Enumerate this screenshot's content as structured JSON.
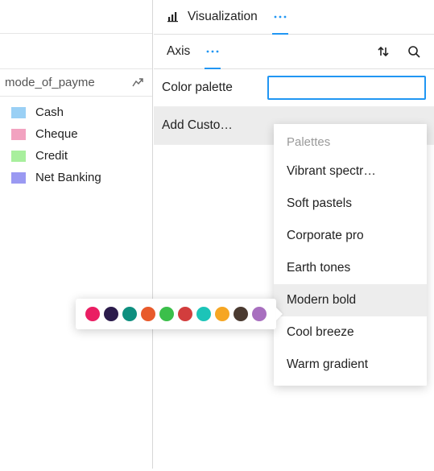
{
  "legend": {
    "title": "mode_of_payme",
    "items": [
      {
        "label": "Cash",
        "color": "#9ad0f5"
      },
      {
        "label": "Cheque",
        "color": "#f2a2c0"
      },
      {
        "label": "Credit",
        "color": "#a8ef9d"
      },
      {
        "label": "Net Banking",
        "color": "#9a99f2"
      }
    ]
  },
  "tabs": {
    "row1": {
      "label": "Visualization"
    },
    "row2": {
      "label": "Axis"
    }
  },
  "props": {
    "color_palette_label": "Color palette",
    "color_palette_value": "",
    "add_custom_label": "Add Custo…"
  },
  "dropdown": {
    "header": "Palettes",
    "items": [
      {
        "label": "Vibrant spectr…",
        "hover": false
      },
      {
        "label": "Soft pastels",
        "hover": false
      },
      {
        "label": "Corporate pro",
        "hover": false
      },
      {
        "label": "Earth tones",
        "hover": false
      },
      {
        "label": "Modern bold",
        "hover": true
      },
      {
        "label": "Cool breeze",
        "hover": false
      },
      {
        "label": "Warm gradient",
        "hover": false
      }
    ]
  },
  "palette_preview": {
    "colors": [
      "#ea1e63",
      "#2b1b4b",
      "#0e8f7f",
      "#e85a2b",
      "#3bbf4a",
      "#d23d3d",
      "#1cc4b8",
      "#f6a623",
      "#4a3a30",
      "#a86fbf"
    ]
  }
}
